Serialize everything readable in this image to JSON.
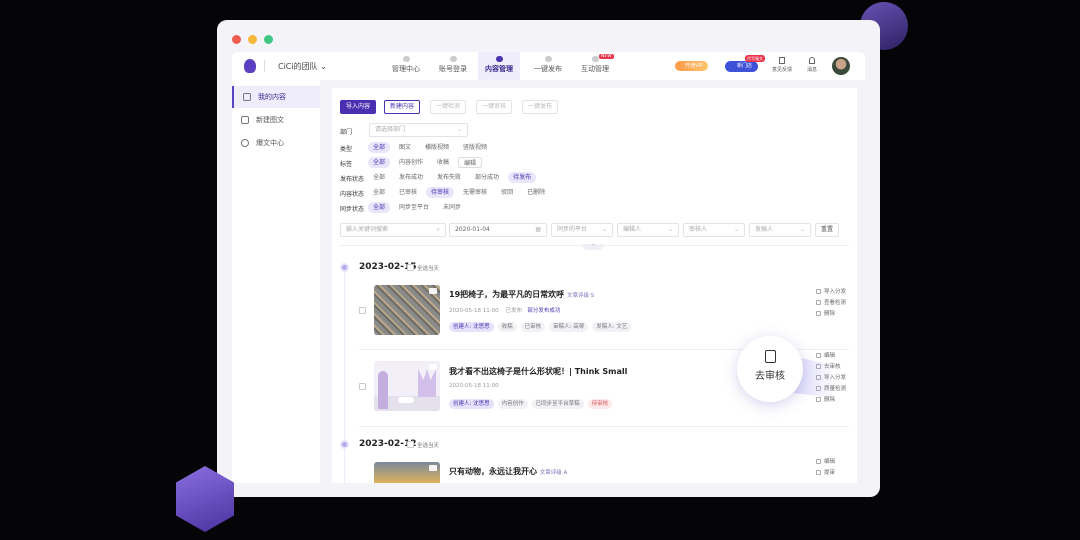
{
  "team": "CiCi的团队",
  "nav": [
    {
      "label": "管理中心"
    },
    {
      "label": "账号登录"
    },
    {
      "label": "内容管理"
    },
    {
      "label": "一键发布"
    },
    {
      "label": "互动管理"
    }
  ],
  "nav_badge": "NEW",
  "header": {
    "vip": "开通VIP",
    "new_btn": "新门店",
    "new_badge": "代写服文",
    "feedback": "意见反馈",
    "messages": "消息"
  },
  "sidebar": [
    {
      "label": "我的内容"
    },
    {
      "label": "新建图文"
    },
    {
      "label": "爆文中心"
    }
  ],
  "toolbar": [
    "导入内容",
    "新建内容",
    "一键检测",
    "一键审核",
    "一键发布"
  ],
  "filters": {
    "dept_label": "部门",
    "dept_placeholder": "请选择部门",
    "rows": [
      {
        "label": "类型",
        "options": [
          "全部",
          "图文",
          "横版视频",
          "竖版视频"
        ]
      },
      {
        "label": "标签",
        "options": [
          "全部",
          "内容创作",
          "收稿",
          "编辑"
        ]
      },
      {
        "label": "发布状态",
        "options": [
          "全部",
          "发布成功",
          "发布失败",
          "部分成功",
          "待发布"
        ]
      },
      {
        "label": "内容状态",
        "options": [
          "全部",
          "已审核",
          "待审核",
          "无需审核",
          "驳回",
          "已删除"
        ]
      },
      {
        "label": "同步状态",
        "options": [
          "全部",
          "同步至平台",
          "未同步"
        ]
      }
    ]
  },
  "search": {
    "placeholder": "输入关键词搜索",
    "date": "2020-01-04",
    "platform": "同步的平台",
    "editor": "编辑人",
    "reviewer": "审核人",
    "publisher": "发稿人",
    "reset": "重置"
  },
  "select_all_day": "全选当天",
  "groups": [
    {
      "date": "2023-02-15",
      "items": [
        {
          "title": "19把椅子，为最平凡的日常欢呼",
          "grade": "文章评级 S",
          "time": "2020-05-18 11:00",
          "status": "已发布",
          "status2": "部分发布成功",
          "tags": [
            "创建人: 沈思思",
            "收稿",
            "已审核",
            "审稿人: 高琴",
            "发稿人: 文艺"
          ],
          "actions": [
            "导入分发",
            "查看检测",
            "删除"
          ]
        },
        {
          "title": "我才看不出这椅子是什么形状呢！| Think Small",
          "time": "2020-05-18 11:00",
          "tags": [
            "创建人: 沈思思",
            "内容创作",
            "已同步至平台草稿",
            "待审核"
          ],
          "actions": [
            "编辑",
            "去审核",
            "导入分发",
            "质量检测",
            "删除"
          ]
        }
      ]
    },
    {
      "date": "2023-02-12",
      "items": [
        {
          "title": "只有动物，永远让我开心",
          "grade": "文章评级 A",
          "actions": [
            "编辑",
            "提审"
          ]
        }
      ]
    }
  ],
  "callout": "去审核",
  "colors": {
    "accent": "#4a2fb0",
    "light": "#e9e5fb"
  }
}
